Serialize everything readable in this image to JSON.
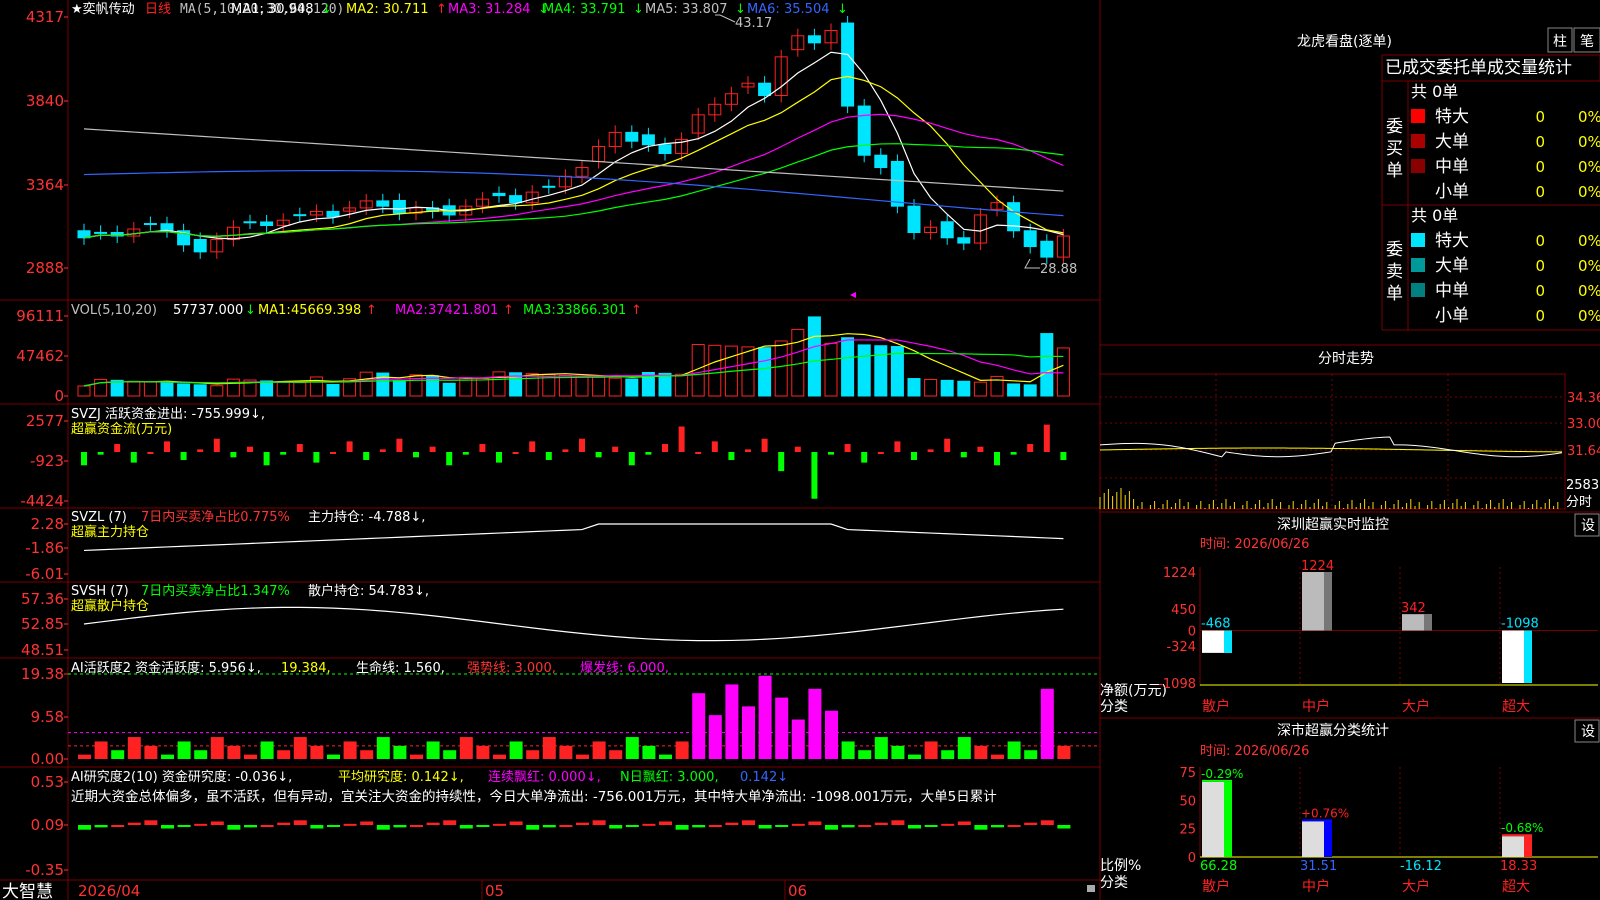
{
  "colors": {
    "bg": "#000000",
    "grid": "#7a0000",
    "up": "#ff2222",
    "down": "#00e5ff",
    "yellow": "#ffff00",
    "white": "#ffffff",
    "magenta": "#ff00ff",
    "green": "#00ff00",
    "orange": "#ff8800",
    "blue": "#3366ff",
    "gray": "#c0c0c0"
  },
  "main": {
    "stock": "★奕帆传动",
    "period": "日线",
    "ma_header": "MA(5,10,20,30,60,120)",
    "ma_values": [
      {
        "label": "MA1:",
        "value": "30.948",
        "arrow": "↓"
      },
      {
        "label": "MA2:",
        "value": "30.711",
        "arrow": "↑"
      },
      {
        "label": "MA3:",
        "value": "31.284",
        "arrow": "↓"
      },
      {
        "label": "MA4:",
        "value": "33.791",
        "arrow": "↓"
      },
      {
        "label": "MA5:",
        "value": "33.807",
        "arrow": "↓"
      },
      {
        "label": "MA6:",
        "value": "35.504",
        "arrow": "↓"
      }
    ],
    "yticks": [
      "4317",
      "3840",
      "3364",
      "2888"
    ],
    "high_label": "43.17",
    "low_label": "28.88"
  },
  "vol": {
    "title": "VOL(5,10,20)",
    "v0": "57737.000",
    "a0": "↓",
    "items": [
      {
        "label": "MA1:",
        "value": "45669.398",
        "arrow": "↑"
      },
      {
        "label": "MA2:",
        "value": "37421.801",
        "arrow": "↑"
      },
      {
        "label": "MA3:",
        "value": "33866.301",
        "arrow": "↑"
      }
    ],
    "yticks": [
      "96111",
      "47462",
      "0"
    ]
  },
  "svzj": {
    "line1": "SVZJ  活跃资金进出: -755.999↓,",
    "line2": "超赢资金流(万元)",
    "yticks": [
      "2577",
      "-923",
      "-4424"
    ]
  },
  "svzl": {
    "p1": "SVZL (7)",
    "p2": "7日内买卖净占比0.775%",
    "p3": "主力持仓: -4.788↓,",
    "line2": "超赢主力持仓",
    "yticks": [
      "2.28",
      "-1.86",
      "-6.01"
    ]
  },
  "svsh": {
    "p1": "SVSH (7)",
    "p2": "7日内买卖净占比1.347%",
    "p3": "散户持仓: 54.783↓,",
    "line2": "超赢散户持仓",
    "yticks": [
      "57.36",
      "52.85",
      "48.51"
    ]
  },
  "ai2": {
    "p1": "AI活跃度2 资金活跃度: 5.956↓,",
    "p2": "19.384,",
    "p3": "生命线: 1.560,",
    "p4": "强势线: 3.000,",
    "p5": "爆发线: 6.000,",
    "yticks": [
      "19.38",
      "9.58",
      "0.00"
    ]
  },
  "ai3": {
    "p1": "AI研究度2(10) 资金研究度: -0.036↓,",
    "p2": "平均研究度: 0.142↓,",
    "p3": "连续飘红: 0.000↓,",
    "p4": "N日飘红: 3.000,",
    "p5": "0.142↓",
    "comment": "近期大资金总体偏多，虽不活跃，但有异动，宜关注大资金的持续性，今日大单净流出: -756.001万元，其中特大单净流出: -1098.001万元，大单5日累计",
    "yticks": [
      "0.53",
      "0.09",
      "-0.35"
    ]
  },
  "xaxis": {
    "brand": "大智慧",
    "dates": [
      "2026/04",
      "05",
      "06"
    ]
  },
  "right": {
    "dragon": {
      "title": "龙虎看盘(逐单)",
      "btn1": "柱",
      "btn2": "笔",
      "subtitle": "已成交委托单成交量统计",
      "buy": {
        "side": "委买单",
        "total": "共 0单",
        "rows": [
          {
            "name": "特大",
            "v": "0",
            "p": "0%"
          },
          {
            "name": "大单",
            "v": "0",
            "p": "0%"
          },
          {
            "name": "中单",
            "v": "0",
            "p": "0%"
          },
          {
            "name": "小单",
            "v": "0",
            "p": "0%"
          }
        ]
      },
      "sell": {
        "side": "委卖单",
        "total": "共 0单",
        "rows": [
          {
            "name": "特大",
            "v": "0",
            "p": "0%"
          },
          {
            "name": "大单",
            "v": "0",
            "p": "0%"
          },
          {
            "name": "中单",
            "v": "0",
            "p": "0%"
          },
          {
            "name": "小单",
            "v": "0",
            "p": "0%"
          }
        ]
      }
    },
    "fenshi": {
      "title": "分时走势",
      "yticks": [
        "34.36",
        "33.00",
        "31.64"
      ],
      "vol_tick": "2583",
      "vol_label": "分时"
    },
    "monitor": {
      "title": "深圳超赢实时监控",
      "btn": "设",
      "time": "时间: 2026/06/26",
      "yticks": [
        "1224",
        "450",
        "0",
        "-324",
        "-1098"
      ],
      "ylabel": "净额(万元)",
      "xlabel": "分类",
      "bars": [
        {
          "cat": "散户",
          "value": -468,
          "label": "-468"
        },
        {
          "cat": "中户",
          "value": 1224,
          "label": "1224"
        },
        {
          "cat": "大户",
          "value": 342,
          "label": "342"
        },
        {
          "cat": "超大",
          "value": -1098,
          "label": "-1098"
        }
      ]
    },
    "stats": {
      "title": "深市超赢分类统计",
      "btn": "设",
      "time": "时间: 2026/06/26",
      "yticks": [
        "75",
        "50",
        "25",
        "0"
      ],
      "ylabel": "比例%",
      "xlabel": "分类",
      "bars": [
        {
          "cat": "散户",
          "value": 66.28,
          "change": "-0.29%"
        },
        {
          "cat": "中户",
          "value": 31.51,
          "change": "+0.76%"
        },
        {
          "cat": "大户",
          "value": -16.12,
          "change": ""
        },
        {
          "cat": "超大",
          "value": 18.33,
          "change": "-0.68%"
        }
      ]
    }
  }
}
